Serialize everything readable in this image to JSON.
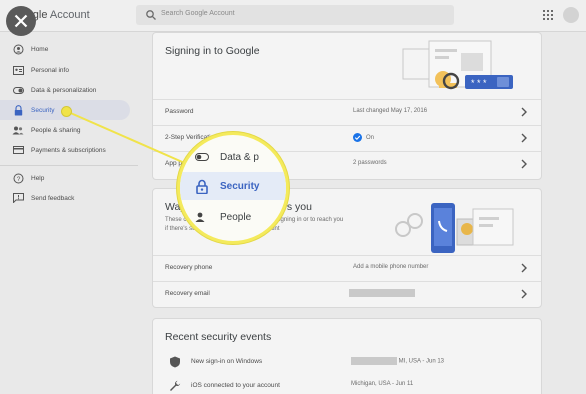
{
  "header": {
    "brand_prefix": "Google",
    "brand_suffix": " Account",
    "search_placeholder": "Search Google Account"
  },
  "sidebar": {
    "items": [
      {
        "label": "Home",
        "icon": "home-icon"
      },
      {
        "label": "Personal info",
        "icon": "id-card-icon"
      },
      {
        "label": "Data & personalization",
        "icon": "toggle-icon"
      },
      {
        "label": "Security",
        "icon": "lock-icon",
        "active": true
      },
      {
        "label": "People & sharing",
        "icon": "people-icon"
      },
      {
        "label": "Payments & subscriptions",
        "icon": "credit-card-icon"
      },
      {
        "label": "Help",
        "icon": "help-icon"
      },
      {
        "label": "Send feedback",
        "icon": "feedback-icon"
      }
    ]
  },
  "signin_card": {
    "title": "Signing in to Google",
    "rows": [
      {
        "label": "Password",
        "value": "Last changed May 17, 2016"
      },
      {
        "label": "2-Step Verification",
        "value": "On"
      },
      {
        "label": "App pa",
        "value": "2 passwords"
      }
    ]
  },
  "ways_card": {
    "title_left": "Ways",
    "title_right": "s you",
    "desc_left": "These can",
    "desc_right": "re it's really you signing in or to reach you",
    "desc_line2": "if there's suspicious activity in your account",
    "rows": [
      {
        "label": "Recovery phone",
        "value": "Add a mobile phone number"
      },
      {
        "label": "Recovery email",
        "value": ""
      }
    ]
  },
  "events_card": {
    "title": "Recent security events",
    "events": [
      {
        "label": "New sign-in on Windows",
        "value": "MI, USA - Jun 13",
        "icon": "shield-icon"
      },
      {
        "label": "iOS connected to your account",
        "value": "Michigan, USA - Jun 11",
        "icon": "wrench-icon"
      }
    ]
  },
  "magnifier": {
    "items": [
      "Data & p",
      "Security",
      "People"
    ]
  },
  "colors": {
    "accent": "#3b64c1",
    "highlight": "#f4ea5c",
    "check": "#1a73e8"
  }
}
